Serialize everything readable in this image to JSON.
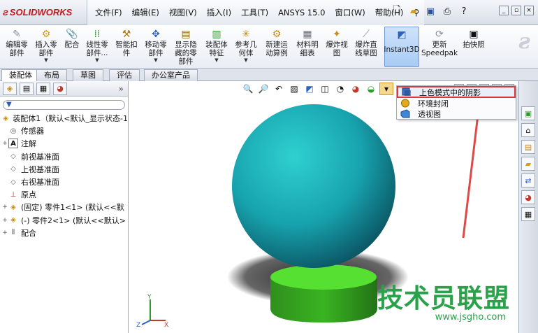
{
  "app": {
    "logo_text": "SOLIDWORKS",
    "brand_color": "#c4161c"
  },
  "menu": [
    "文件(F)",
    "编辑(E)",
    "视图(V)",
    "插入(I)",
    "工具(T)",
    "ANSYS 15.0",
    "窗口(W)",
    "帮助(H)"
  ],
  "commands": [
    {
      "label": "编辑零\n部件",
      "icon": "edit-component-icon"
    },
    {
      "label": "插入零\n部件",
      "icon": "insert-component-icon",
      "dropdown": true
    },
    {
      "label": "配合",
      "icon": "mate-icon"
    },
    {
      "label": "线性零\n部件...",
      "icon": "linear-pattern-icon",
      "dropdown": true
    },
    {
      "label": "智能扣\n件",
      "icon": "smart-fastener-icon"
    },
    {
      "label": "移动零\n部件",
      "icon": "move-component-icon",
      "dropdown": true
    },
    {
      "label": "显示隐\n藏的零\n部件",
      "icon": "show-hidden-icon"
    },
    {
      "label": "装配体\n特征",
      "icon": "assembly-feature-icon",
      "dropdown": true
    },
    {
      "label": "参考几\n何体",
      "icon": "reference-geometry-icon",
      "dropdown": true
    },
    {
      "label": "新建运\n动算例",
      "icon": "new-motion-study-icon"
    },
    {
      "label": "材料明\n细表",
      "icon": "bom-icon"
    },
    {
      "label": "爆炸视\n图",
      "icon": "exploded-view-icon"
    },
    {
      "label": "爆炸直\n线草图",
      "icon": "explode-line-sketch-icon"
    },
    {
      "label": "Instant3D",
      "icon": "instant3d-icon",
      "active": true
    },
    {
      "label": "更新\nSpeedpak",
      "icon": "update-speedpak-icon"
    },
    {
      "label": "拍快照",
      "icon": "snapshot-icon"
    }
  ],
  "tabs": [
    "装配体",
    "布局",
    "草图",
    "评估",
    "办公室产品"
  ],
  "tree": {
    "filter_label": "▼",
    "items": [
      {
        "label": "装配体1（默认<默认_显示状态-1",
        "icon": "assembly-icon",
        "indent": 0
      },
      {
        "label": "传感器",
        "icon": "sensor-icon",
        "indent": 1
      },
      {
        "label": "注解",
        "icon": "annotation-icon",
        "indent": 1,
        "expand": "+"
      },
      {
        "label": "前视基准面",
        "icon": "plane-icon",
        "indent": 1
      },
      {
        "label": "上视基准面",
        "icon": "plane-icon",
        "indent": 1
      },
      {
        "label": "右视基准面",
        "icon": "plane-icon",
        "indent": 1
      },
      {
        "label": "原点",
        "icon": "origin-icon",
        "indent": 1
      },
      {
        "label": "(固定) 零件1<1> (默认<<默",
        "icon": "part-icon",
        "indent": 1,
        "expand": "+"
      },
      {
        "label": "(-) 零件2<1> (默认<<默认>",
        "icon": "part-icon",
        "indent": 1,
        "expand": "+"
      },
      {
        "label": "配合",
        "icon": "mates-folder-icon",
        "indent": 1,
        "expand": "+"
      }
    ]
  },
  "shading_menu": {
    "items": [
      {
        "label": "上色模式中的阴影",
        "icon": "shadows-icon",
        "highlighted": true
      },
      {
        "label": "环境封闭",
        "icon": "ambient-occlusion-icon"
      },
      {
        "label": "透视图",
        "icon": "perspective-icon"
      }
    ],
    "highlight_color": "#d93b3b"
  },
  "axis_labels": {
    "x": "X",
    "y": "Y",
    "z": "Z"
  },
  "watermark": {
    "text": "技术员联盟",
    "url": "www.jsgho.com",
    "color": "#2aa24a"
  }
}
